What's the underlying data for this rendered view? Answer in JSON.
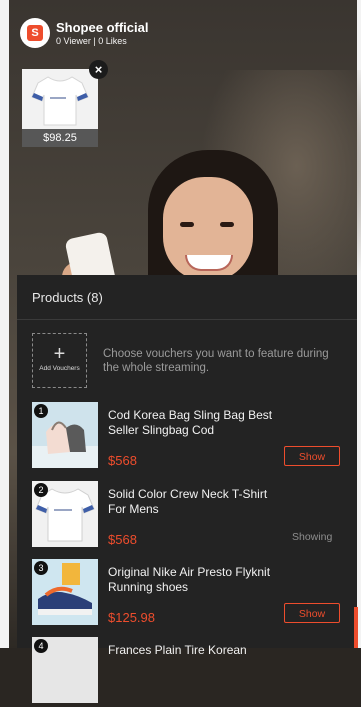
{
  "header": {
    "name": "Shopee official",
    "stats": "0 Viewer | 0 Likes",
    "logo_letter": "S"
  },
  "pinned": {
    "price": "$98.25"
  },
  "panel": {
    "title": "Products (8)",
    "add_vouchers": {
      "label": "Add Vouchers",
      "hint": "Choose vouchers you want to feature during the whole streaming."
    },
    "items": [
      {
        "num": "1",
        "name": "Cod Korea Bag Sling Bag Best Seller Slingbag Cod",
        "price": "$568",
        "action": "Show"
      },
      {
        "num": "2",
        "name": "Solid Color Crew Neck T-Shirt For Mens",
        "price": "$568",
        "action": "Showing"
      },
      {
        "num": "3",
        "name": "Original Nike Air Presto Flyknit Running shoes",
        "price": "$125.98",
        "action": "Show"
      },
      {
        "num": "4",
        "name": "Frances Plain Tire Korean",
        "price": "",
        "action": ""
      }
    ]
  },
  "colors": {
    "accent": "#ee4d2d",
    "panel_bg": "#232323"
  }
}
